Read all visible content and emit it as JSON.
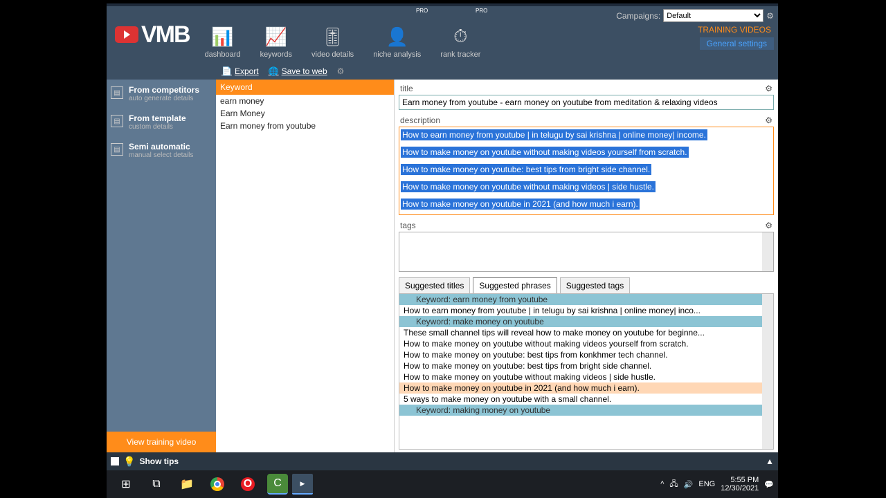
{
  "header": {
    "logo": "VMB",
    "nav": [
      {
        "label": "dashboard",
        "icon": "📊"
      },
      {
        "label": "keywords",
        "icon": "📈"
      },
      {
        "label": "video details",
        "icon": "🎚"
      },
      {
        "label": "niche analysis",
        "icon": "👤",
        "pro": "PRO"
      },
      {
        "label": "rank tracker",
        "icon": "⏱",
        "pro": "PRO"
      }
    ],
    "campaigns_label": "Campaigns:",
    "campaign_selected": "Default",
    "training": "TRAINING VIDEOS",
    "settings": "General settings"
  },
  "toolbar": {
    "export": "Export",
    "save_web": "Save to web"
  },
  "sidebar": {
    "items": [
      {
        "title": "From competitors",
        "sub": "auto generate details"
      },
      {
        "title": "From template",
        "sub": "custom details"
      },
      {
        "title": "Semi automatic",
        "sub": "manual select details"
      }
    ],
    "footer": "View training video"
  },
  "keywords": {
    "header": "Keyword",
    "list": [
      "earn money",
      "Earn Money",
      "Earn money from youtube"
    ]
  },
  "fields": {
    "title_label": "title",
    "title_value": "Earn money from youtube - earn money on youtube from meditation & relaxing videos",
    "desc_label": "description",
    "desc_lines": [
      "How to earn money from youtube | in telugu by sai krishna | online money| income.",
      "How to make money on youtube without making videos yourself from scratch.",
      "How to make money on youtube: best tips from bright side channel.",
      "How to make money on youtube without making videos | side hustle.",
      "How to make money on youtube in 2021 (and how much i earn)."
    ],
    "tags_label": "tags"
  },
  "tabs": {
    "titles": "Suggested titles",
    "phrases": "Suggested phrases",
    "tags": "Suggested tags"
  },
  "suggestions": [
    {
      "text": "Keyword: earn money from youtube",
      "type": "kw"
    },
    {
      "text": "How to earn money from youtube | in telugu by sai krishna | online money| inco...",
      "type": "row"
    },
    {
      "text": "Keyword: make money on youtube",
      "type": "kw"
    },
    {
      "text": "These small channel tips will reveal how to make money on youtube for beginne...",
      "type": "row"
    },
    {
      "text": "How to make money on youtube without making videos yourself from scratch.",
      "type": "row"
    },
    {
      "text": "How to make money on youtube: best tips from konkhmer tech channel.",
      "type": "row"
    },
    {
      "text": "How to make money on youtube: best tips from bright side channel.",
      "type": "row"
    },
    {
      "text": "How to make money on youtube without making videos | side hustle.",
      "type": "row"
    },
    {
      "text": "How to make money on youtube in 2021 (and how much i earn).",
      "type": "hl"
    },
    {
      "text": "5 ways to make money on youtube with a small channel.",
      "type": "row"
    },
    {
      "text": "Keyword: making money on youtube",
      "type": "kw"
    }
  ],
  "status": {
    "tips": "Show tips"
  },
  "taskbar": {
    "tray": {
      "lang": "ENG",
      "time": "5:55 PM",
      "date": "12/30/2021"
    }
  }
}
